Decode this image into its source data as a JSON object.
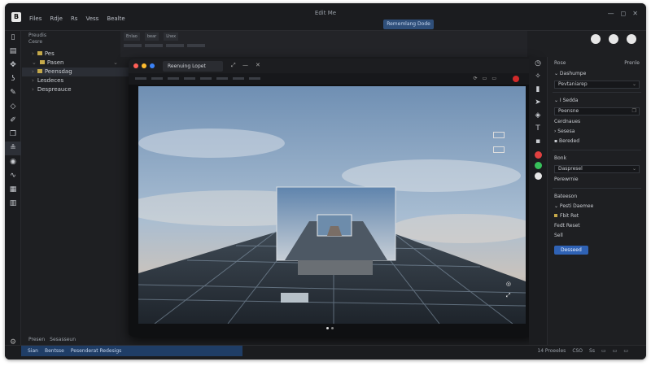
{
  "app": {
    "title": "Edit Me",
    "menu": [
      "Files",
      "Rdje",
      "Rs",
      "Vess",
      "Bealte"
    ],
    "title_button": "Rememlang Dode",
    "window_controls": [
      "—",
      "◻",
      "✕"
    ]
  },
  "explorer": {
    "header": [
      "Preudis",
      "Cesre"
    ],
    "items": [
      {
        "label": "Pes",
        "selected": false
      },
      {
        "label": "Pasen",
        "selected": false
      },
      {
        "label": "Peensdag",
        "selected": true
      },
      {
        "label": "Lesdeces",
        "selected": false
      },
      {
        "label": "Despreauce",
        "selected": false
      }
    ],
    "bottom_tabs": [
      "Presen",
      "Sesasseun"
    ]
  },
  "center_toolbar": {
    "tabs": [
      "Enlao",
      "bear",
      "Lhex"
    ]
  },
  "preview_window": {
    "tab_label": "Reenuing Lopet",
    "close": "✕",
    "controls": [
      "⤢",
      "—",
      "✕"
    ],
    "toolbar_right": [
      "⟳",
      "▭",
      "▭"
    ]
  },
  "right_panel": {
    "header": [
      "Rose",
      "Prenle"
    ],
    "rows": [
      {
        "type": "row",
        "text": "⌄ Dashumpe"
      },
      {
        "type": "field",
        "text": "Pevtaniarep"
      },
      {
        "type": "row",
        "text": "⌄ I Sedda"
      },
      {
        "type": "field",
        "text": "Peensne"
      },
      {
        "type": "row",
        "text": "Cerdnaues"
      },
      {
        "type": "row",
        "text": "› Sesesa"
      },
      {
        "type": "row",
        "text": "▪ Bereded"
      },
      {
        "type": "row",
        "text": "Bonk"
      },
      {
        "type": "field",
        "text": "Daspresel"
      },
      {
        "type": "row",
        "text": "Perewrnie"
      },
      {
        "type": "row",
        "text": "Bateeson"
      },
      {
        "type": "row",
        "text": "⌄ Pesti Daemee"
      },
      {
        "type": "row",
        "text": "Fbit Ret"
      },
      {
        "type": "row",
        "text": "Fedt Reset"
      },
      {
        "type": "row",
        "text": "Sell"
      }
    ],
    "button": "Desseed"
  },
  "status": {
    "left": [
      "Sian",
      "Bentsse",
      "Pesenderat Redesigs"
    ],
    "right": [
      "14 Proeeles",
      "CSO",
      "Ss",
      "▭",
      "▭",
      "▭"
    ]
  },
  "colors": {
    "accent": "#2f62b5",
    "status_bar": "#1f3d66",
    "record": "#d12a2a",
    "green": "#37c05a"
  }
}
